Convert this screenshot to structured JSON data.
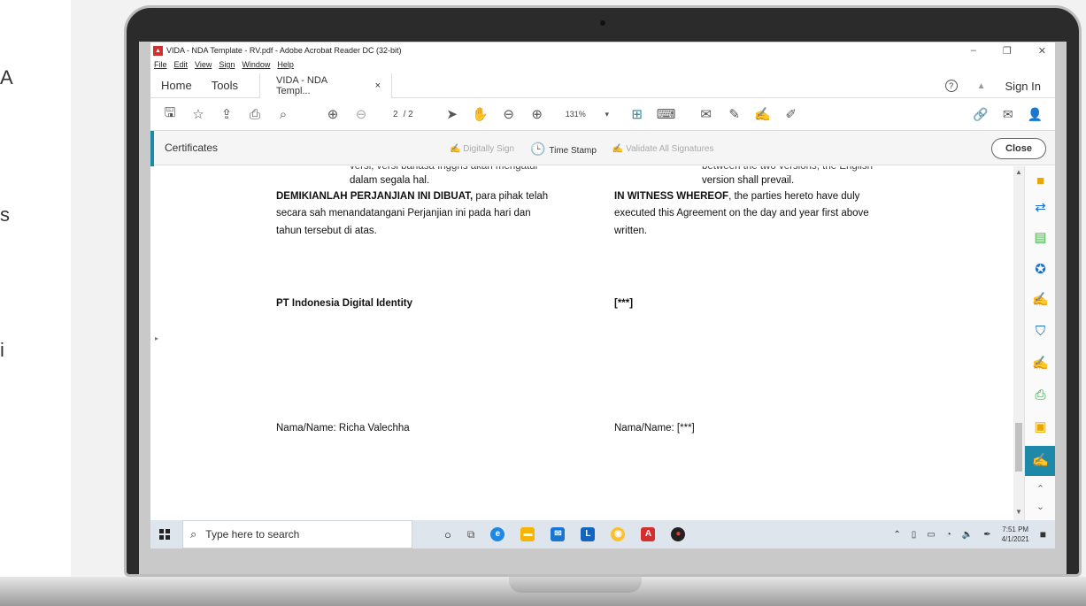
{
  "side_text": [
    "A",
    "s",
    "i"
  ],
  "window": {
    "title": "VIDA - NDA Template - RV.pdf - Adobe Acrobat Reader DC (32-bit)",
    "controls": [
      "–",
      "❐",
      "✕"
    ]
  },
  "menu": [
    "File",
    "Edit",
    "View",
    "Sign",
    "Window",
    "Help"
  ],
  "tabs": {
    "home": "Home",
    "tools": "Tools",
    "doc": "VIDA - NDA Templ...",
    "doc_close": "×",
    "help": "?",
    "bell": "▲",
    "signin": "Sign In"
  },
  "toolbar": {
    "page_current": "2",
    "page_total": "/ 2",
    "zoom": "131%"
  },
  "certificates": {
    "title": "Certificates",
    "digitally_sign": "Digitally Sign",
    "time_stamp": "Time Stamp",
    "validate": "Validate All Signatures",
    "close": "Close"
  },
  "document": {
    "left_top_cut": "versi, versi bahasa Inggris akan mengatur",
    "left_line1": "dalam segala hal.",
    "left_bold": "DEMIKIANLAH PERJANJIAN INI DIBUAT,",
    "left_rest1": " para pihak telah",
    "left_line3": "secara sah menandatangani Perjanjian ini pada hari dan",
    "left_line4": "tahun tersebut di atas.",
    "right_top_cut": "between the two versions, the English",
    "right_line1": "version shall prevail.",
    "right_bold": "IN WITNESS WHEREOF",
    "right_rest1": ", the parties hereto have duly",
    "right_line3": "executed this Agreement on the day and year first above",
    "right_line4": "written.",
    "left_party": "PT Indonesia Digital Identity",
    "right_party": "[***]",
    "left_name": "Nama/Name: Richa Valechha",
    "right_name": "Nama/Name: [***]"
  },
  "taskbar": {
    "search_placeholder": "Type here to search",
    "time": "7:51 PM",
    "date": "4/1/2021"
  },
  "colors": {
    "accent": "#1e88a8",
    "taskbar": "#dfe5ec"
  }
}
